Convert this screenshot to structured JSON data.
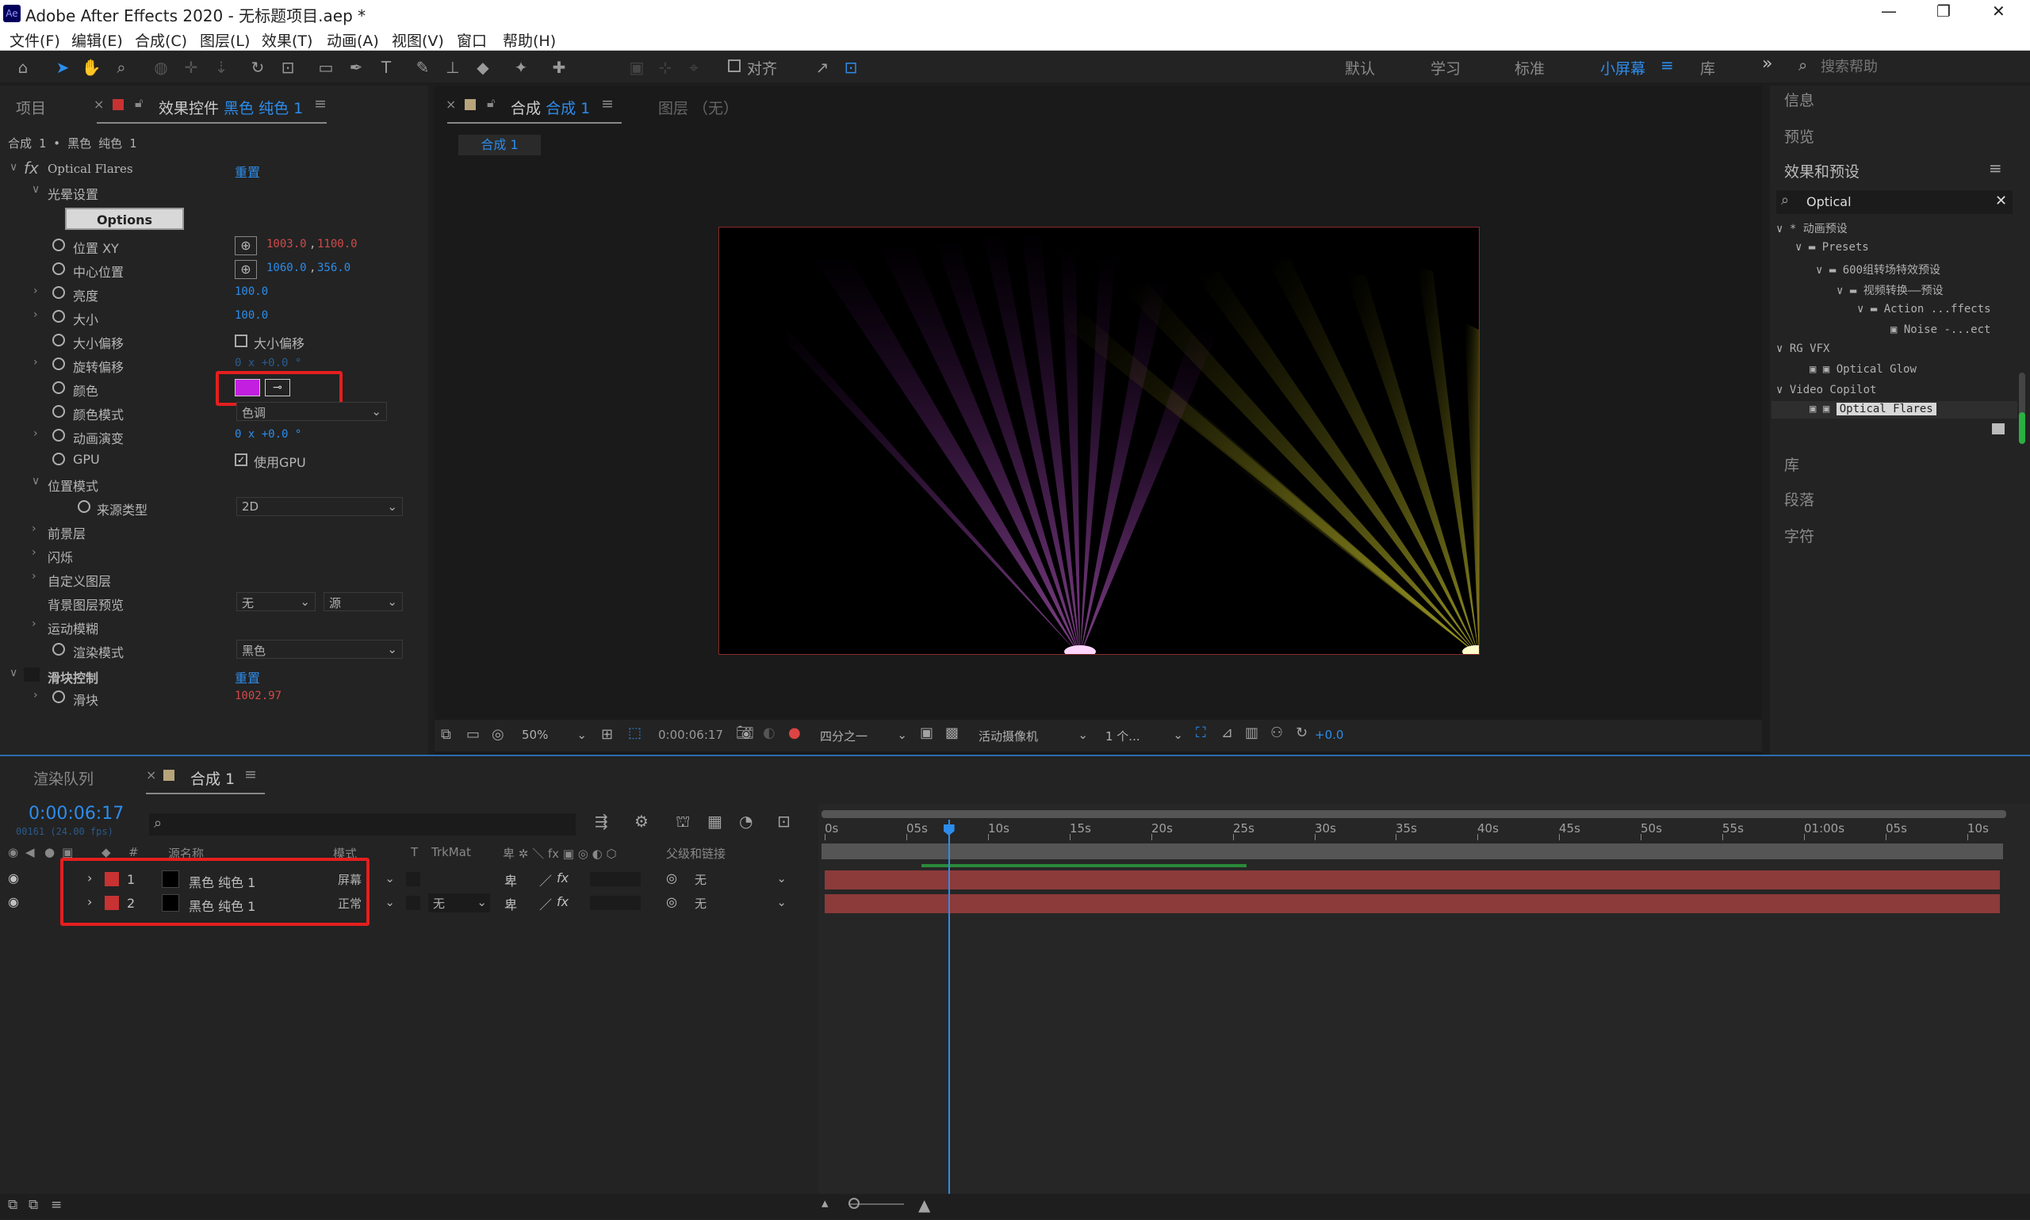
{
  "window": {
    "title": "Adobe After Effects 2020 - 无标题项目.aep *",
    "app_icon": "Ae",
    "controls": [
      "—",
      "❐",
      "✕"
    ]
  },
  "menu": [
    "文件(F)",
    "编辑(E)",
    "合成(C)",
    "图层(L)",
    "效果(T)",
    "动画(A)",
    "视图(V)",
    "窗口",
    "帮助(H)"
  ],
  "toolbar": {
    "align_label": "对齐",
    "workspaces": [
      "默认",
      "学习",
      "标准",
      "小屏幕",
      "库"
    ],
    "active_workspace": "小屏幕",
    "search_placeholder": "搜索帮助"
  },
  "left_panel": {
    "tab_project": "项目",
    "tab_effects_prefix": "效果控件",
    "tab_effects_layer": "黑色 纯色 1",
    "breadcrumb": "合成 1 • 黑色 纯色 1",
    "effect_name": "Optical Flares",
    "reset": "重置",
    "group_flare": "光晕设置",
    "options_button": "Options",
    "props": [
      {
        "label": "位置 XY",
        "v1": "1003.0",
        "v2": "1100.0",
        "color": "red"
      },
      {
        "label": "中心位置",
        "v1": "1060.0",
        "v2": "356.0",
        "color": "blue"
      },
      {
        "label": "亮度",
        "v1": "100.0",
        "color": "blue"
      },
      {
        "label": "大小",
        "v1": "100.0",
        "color": "blue"
      },
      {
        "label": "大小偏移",
        "checkbox": "大小偏移"
      },
      {
        "label": "旋转偏移",
        "v1": "0 x +0.0 °",
        "color": "blue"
      },
      {
        "label": "颜色"
      },
      {
        "label": "颜色模式",
        "dropdown": "色调"
      },
      {
        "label": "动画演变",
        "v1": "0 x +0.0 °",
        "color": "blue"
      },
      {
        "label": "GPU",
        "checkbox": "使用GPU"
      }
    ],
    "group_position": "位置模式",
    "source_type_label": "来源类型",
    "source_type": "2D",
    "foreground": "前景层",
    "flicker": "闪烁",
    "custom_layer": "自定义图层",
    "bg_preview": "背景图层预览",
    "bg_preview_v1": "无",
    "bg_preview_v2": "源",
    "motion_blur": "运动模糊",
    "render_mode_label": "渲染模式",
    "render_mode": "黑色",
    "slider_control": "滑块控制",
    "slider_reset": "重置",
    "slider_label": "滑块",
    "slider_value": "1002.97",
    "flare_color": "#c21fe0"
  },
  "comp_panel": {
    "tab_prefix": "合成",
    "tab_comp": "合成 1",
    "tab_layer": "图层 （无）",
    "comp_chip": "合成 1",
    "footer": {
      "zoom": "50%",
      "timecode": "0:00:06:17",
      "resolution": "四分之一",
      "camera": "活动摄像机",
      "views": "1 个...",
      "exposure": "+0.0"
    }
  },
  "right_panel": {
    "info": "信息",
    "preview": "预览",
    "effects_presets": "效果和预设",
    "search_value": "Optical",
    "tree": [
      {
        "label": "* 动画预设",
        "depth": 0
      },
      {
        "label": "Presets",
        "depth": 1,
        "folder": true
      },
      {
        "label": "600组转场特效预设",
        "depth": 2,
        "folder": true
      },
      {
        "label": "视频转换——预设",
        "depth": 3,
        "folder": true
      },
      {
        "label": "Action ...ffects",
        "depth": 4,
        "folder": true
      },
      {
        "label": "Noise -...ect",
        "depth": 5,
        "fx": true
      },
      {
        "label": "RG VFX",
        "depth": 0
      },
      {
        "label": "Optical Glow",
        "depth": 2,
        "fx": true
      },
      {
        "label": "Video Copilot",
        "depth": 0
      },
      {
        "label": "Optical Flares",
        "depth": 2,
        "fx": true,
        "selected": true
      }
    ],
    "library": "库",
    "paragraph": "段落",
    "character": "字符"
  },
  "timeline": {
    "tab_render": "渲染队列",
    "tab_comp": "合成 1",
    "timecode": "0:00:06:17",
    "fps_line": "00161 (24.00 fps)",
    "columns": {
      "num": "#",
      "source": "源名称",
      "mode": "模式",
      "t": "T",
      "trkmat": "TrkMat",
      "parent": "父级和链接"
    },
    "ruler": [
      "0s",
      "05s",
      "10s",
      "15s",
      "20s",
      "25s",
      "30s",
      "35s",
      "40s",
      "45s",
      "50s",
      "55s",
      "01:00s",
      "05s",
      "10s"
    ],
    "layers": [
      {
        "num": "1",
        "name": "黑色 纯色 1",
        "mode": "屏幕",
        "trkmat": "",
        "parent": "无"
      },
      {
        "num": "2",
        "name": "黑色 纯色 1",
        "mode": "正常",
        "trkmat": "无",
        "parent": "无"
      }
    ],
    "playhead_fraction": 0.105
  }
}
